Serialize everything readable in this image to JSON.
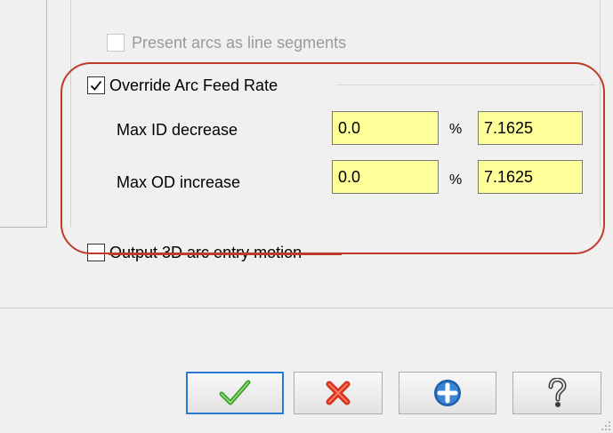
{
  "options": {
    "present_arcs_label": "Present arcs as line segments",
    "present_arcs_checked": false,
    "override_arc_label": "Override Arc Feed Rate",
    "override_arc_checked": true,
    "output_3d_label": "Output 3D arc entry motion",
    "output_3d_checked": false
  },
  "arc_feed": {
    "rows": [
      {
        "label": "Max ID decrease",
        "percent_value": "0.0",
        "percent_symbol": "%",
        "feed_value": "7.1625"
      },
      {
        "label": "Max OD increase",
        "percent_value": "0.0",
        "percent_symbol": "%",
        "feed_value": "7.1625"
      }
    ]
  },
  "buttons": {
    "ok_icon": "green-checkmark-icon",
    "cancel_icon": "red-x-icon",
    "add_icon": "blue-plus-circle-icon",
    "help_icon": "question-mark-icon"
  },
  "colors": {
    "field_bg": "#ffff99",
    "highlight": "#c0392b",
    "default_button_border": "#2b78d4"
  }
}
